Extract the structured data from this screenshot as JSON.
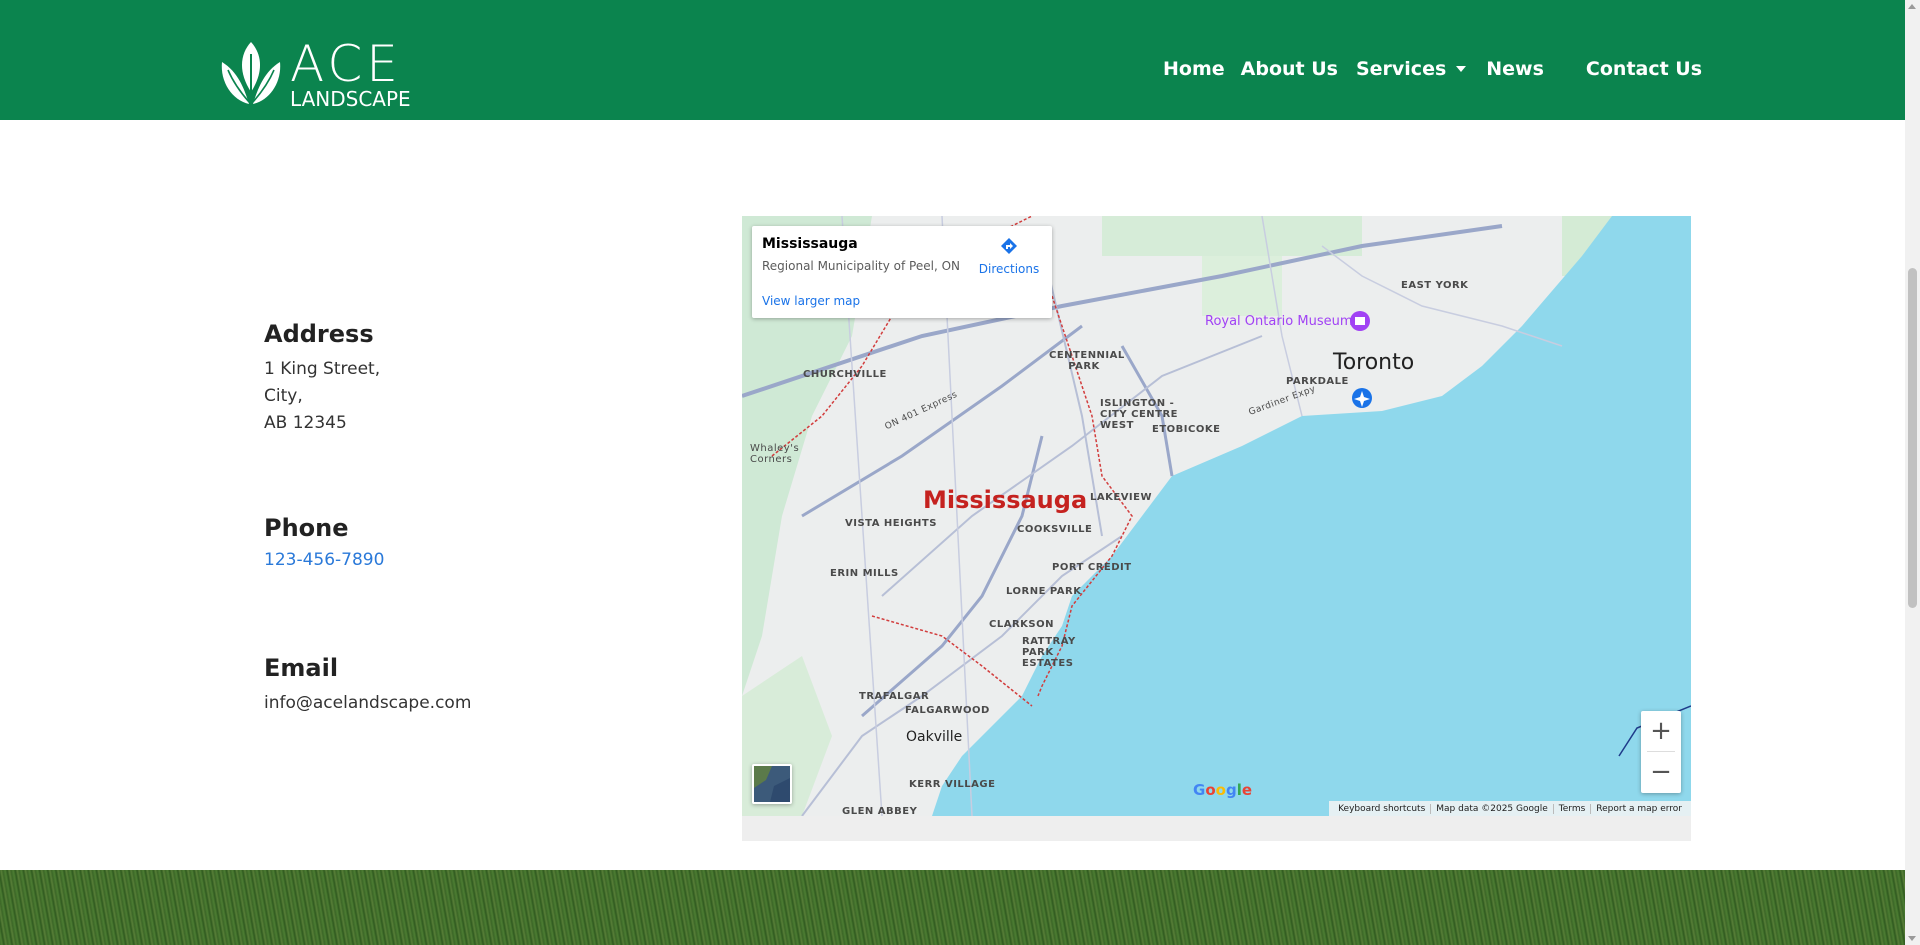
{
  "brand": {
    "line1": "ACE",
    "line2": "LANDSCAPE",
    "color": "#0b844e"
  },
  "nav": {
    "home": "Home",
    "about": "About Us",
    "services": "Services",
    "news": "News",
    "contact": "Contact Us"
  },
  "contact": {
    "address": {
      "heading": "Address",
      "line1": "1 King Street,",
      "line2": "City,",
      "line3": "AB 12345"
    },
    "phone": {
      "heading": "Phone",
      "value": "123-456-7890"
    },
    "email": {
      "heading": "Email",
      "value": "info@acelandscape.com"
    }
  },
  "map": {
    "card": {
      "title": "Mississauga",
      "subtitle": "Regional Municipality of Peel, ON",
      "directions": "Directions",
      "larger_map": "View larger map"
    },
    "labels": {
      "mississauga": "Mississauga",
      "toronto": "Toronto",
      "oakville": "Oakville",
      "royal_ontario_museum": "Royal Ontario Museum",
      "east_york": "EAST YORK",
      "centennial_park": "CENTENNIAL PARK",
      "churchville": "CHURCHVILLE",
      "parkdale": "PARKDALE",
      "islington": "ISLINGTON - CITY CENTRE WEST",
      "etobicoke": "ETOBICOKE",
      "whaleys_corners": "Whaley's Corners",
      "lakeview": "LAKEVIEW",
      "vista_heights": "VISTA HEIGHTS",
      "cooksville": "COOKSVILLE",
      "erin_mills": "ERIN MILLS",
      "port_credit": "PORT CREDIT",
      "lorne_park": "LORNE PARK",
      "clarkson": "CLARKSON",
      "rattray": "RATTRAY PARK ESTATES",
      "trafalgar": "TRAFALGAR",
      "falgarwood": "FALGARWOOD",
      "kerr_village": "KERR VILLAGE",
      "glen_abbey": "GLEN ABBEY",
      "gardiner": "Gardiner Expy",
      "on401": "ON 401 Express"
    },
    "zoom_in": "+",
    "zoom_out": "−",
    "google": "Google",
    "attribution": {
      "shortcuts": "Keyboard shortcuts",
      "data": "Map data ©2025 Google",
      "terms": "Terms",
      "report": "Report a map error"
    }
  }
}
